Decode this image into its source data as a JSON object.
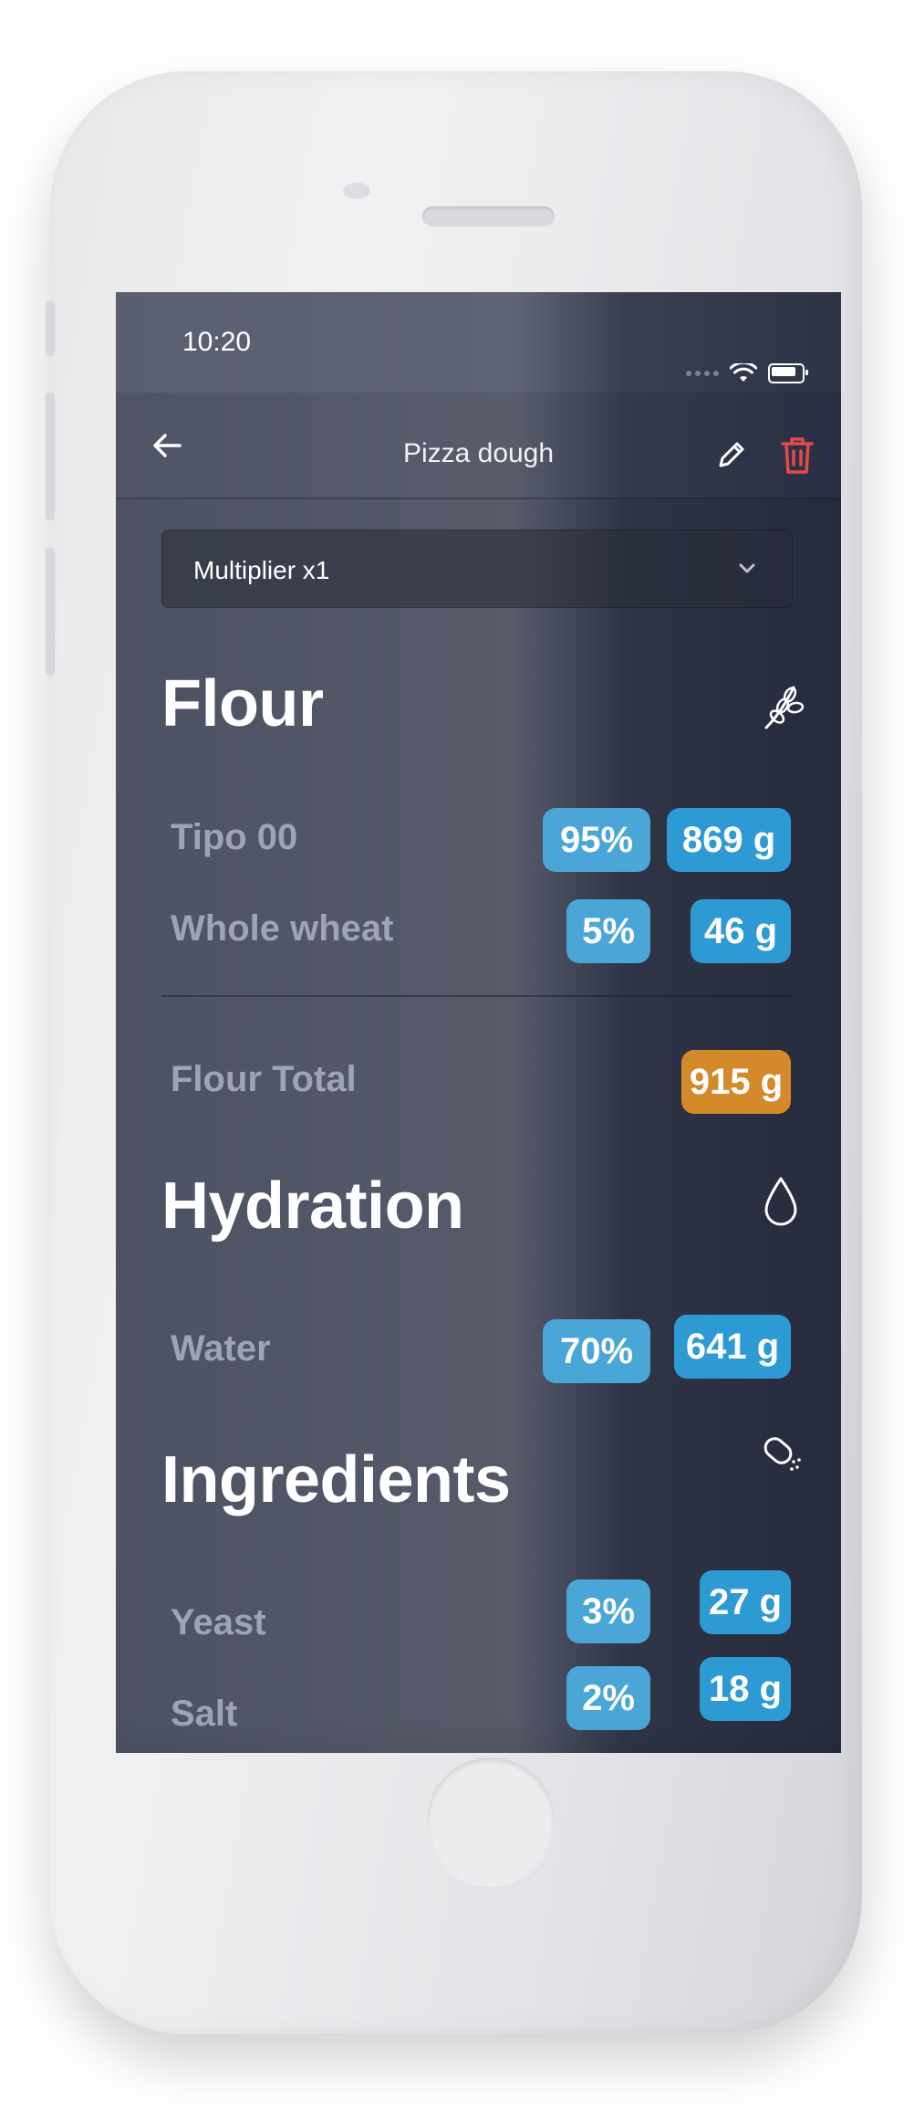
{
  "status_bar": {
    "time": "10:20"
  },
  "nav": {
    "title": "Pizza dough",
    "back_icon": "arrow-left-icon",
    "edit_icon": "pencil-icon",
    "delete_icon": "trash-icon",
    "delete_color": "#e5484d"
  },
  "multiplier": {
    "label": "Multiplier x1"
  },
  "flour": {
    "title": "Flour",
    "icon": "wheat-icon",
    "items": [
      {
        "label": "Tipo 00",
        "percent": "95%",
        "grams": "869 g"
      },
      {
        "label": "Whole wheat",
        "percent": "5%",
        "grams": "46 g"
      }
    ],
    "total_label": "Flour Total",
    "total_value": "915 g"
  },
  "hydration": {
    "title": "Hydration",
    "icon": "water-drop-icon",
    "items": [
      {
        "label": "Water",
        "percent": "70%",
        "grams": "641 g"
      }
    ]
  },
  "ingredients": {
    "title": "Ingredients",
    "icon": "salt-shaker-icon",
    "items": [
      {
        "label": "Yeast",
        "percent": "3%",
        "grams": "27 g"
      },
      {
        "label": "Salt",
        "percent": "2%",
        "grams": "18 g"
      }
    ]
  },
  "colors": {
    "percent_pill": "#4aa6d6",
    "gram_pill": "#2e9ad3",
    "total_pill": "#d4892b",
    "label_gray": "#9ea3b6"
  }
}
